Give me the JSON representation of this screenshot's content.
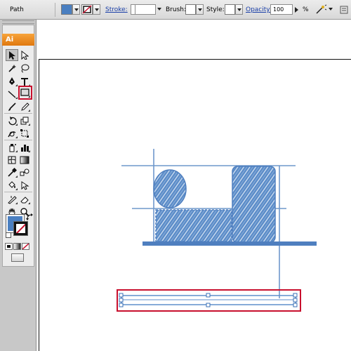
{
  "control_bar": {
    "selection_type": "Path",
    "fill_color": "#4a7fc1",
    "stroke_label": "Stroke:",
    "brush_label": "Brush:",
    "style_label": "Style:",
    "opacity_label": "Opacity:",
    "opacity_value": "100",
    "percent_symbol": "%",
    "icons": [
      "fill-swatch",
      "no-stroke-swatch",
      "stroke-weight-stepper",
      "brush-dropdown",
      "style-dropdown",
      "opacity-arrow",
      "recolor-icon"
    ]
  },
  "tools_panel": {
    "logo_text": "Ai",
    "highlighted_tool": "rectangle-tool",
    "fill_color": "#4a7fc1",
    "stroke_color": "none",
    "tools": [
      "selection-tool",
      "direct-selection-tool",
      "magic-wand-tool",
      "lasso-tool",
      "pen-tool",
      "type-tool",
      "line-segment-tool",
      "rectangle-tool",
      "paintbrush-tool",
      "pencil-tool",
      "rotate-tool",
      "scale-tool",
      "warp-tool",
      "free-transform-tool",
      "symbol-sprayer-tool",
      "column-graph-tool",
      "mesh-tool",
      "gradient-tool",
      "eyedropper-tool",
      "blend-tool",
      "live-paint-bucket-tool",
      "live-paint-selection-tool",
      "slice-tool",
      "eraser-tool",
      "hand-tool",
      "zoom-tool"
    ]
  },
  "artwork": {
    "color": "#5b8cc8",
    "selection_highlight_color": "#c8102e"
  }
}
